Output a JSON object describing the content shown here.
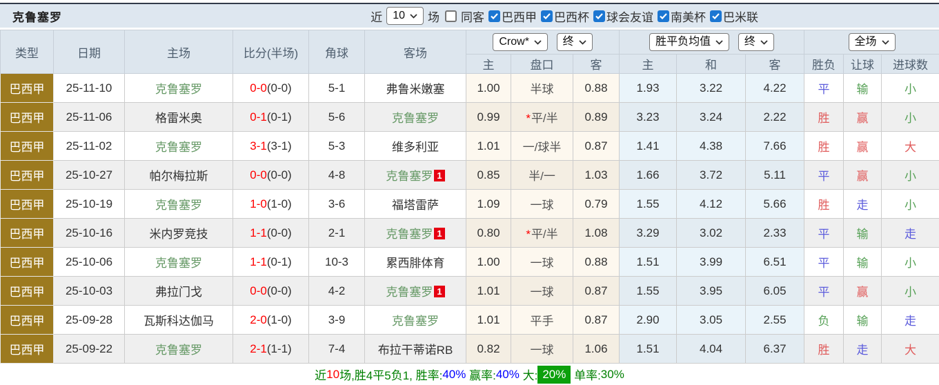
{
  "title": "克鲁塞罗",
  "filters": {
    "near_label": "近",
    "near_count": "10",
    "games_label": "场",
    "same_opponent_label": "同客",
    "competitions": [
      {
        "label": "巴西甲",
        "checked": true
      },
      {
        "label": "巴西杯",
        "checked": true
      },
      {
        "label": "球会友谊",
        "checked": true
      },
      {
        "label": "南美杯",
        "checked": true
      },
      {
        "label": "巴米联",
        "checked": true
      }
    ]
  },
  "table": {
    "headers": [
      "类型",
      "日期",
      "主场",
      "比分(半场)",
      "角球",
      "客场"
    ],
    "selects": {
      "provider": "Crow*",
      "provider_time": "终",
      "mean": "胜平负均值",
      "mean_time": "终",
      "scope": "全场"
    },
    "subheaders": [
      "主",
      "盘口",
      "客",
      "主",
      "和",
      "客",
      "胜负",
      "让球",
      "进球数"
    ],
    "rows": [
      {
        "league": "巴西甲",
        "date": "25-11-10",
        "home": "克鲁塞罗",
        "home_highlight": true,
        "score_ft": "0-0",
        "score_ht": "(0-0)",
        "corner": "5-1",
        "away": "弗鲁米嫩塞",
        "away_highlight": false,
        "away_badge": "",
        "crow_home": "1.00",
        "handicap": "半球",
        "handicap_star": false,
        "crow_away": "0.88",
        "mean_home": "1.93",
        "mean_draw": "3.22",
        "mean_away": "4.22",
        "result": "平",
        "handicap_result": "输",
        "goals": "小"
      },
      {
        "league": "巴西甲",
        "date": "25-11-06",
        "home": "格雷米奥",
        "home_highlight": false,
        "score_ft": "0-1",
        "score_ht": "(0-1)",
        "corner": "5-6",
        "away": "克鲁塞罗",
        "away_highlight": true,
        "away_badge": "",
        "crow_home": "0.99",
        "handicap": "平/半",
        "handicap_star": true,
        "crow_away": "0.89",
        "mean_home": "3.23",
        "mean_draw": "3.24",
        "mean_away": "2.22",
        "result": "胜",
        "handicap_result": "赢",
        "goals": "小"
      },
      {
        "league": "巴西甲",
        "date": "25-11-02",
        "home": "克鲁塞罗",
        "home_highlight": true,
        "score_ft": "3-1",
        "score_ht": "(3-1)",
        "corner": "5-3",
        "away": "维多利亚",
        "away_highlight": false,
        "away_badge": "",
        "crow_home": "1.01",
        "handicap": "一/球半",
        "handicap_star": false,
        "crow_away": "0.87",
        "mean_home": "1.41",
        "mean_draw": "4.38",
        "mean_away": "7.66",
        "result": "胜",
        "handicap_result": "赢",
        "goals": "大"
      },
      {
        "league": "巴西甲",
        "date": "25-10-27",
        "home": "帕尔梅拉斯",
        "home_highlight": false,
        "score_ft": "0-0",
        "score_ht": "(0-0)",
        "corner": "4-8",
        "away": "克鲁塞罗",
        "away_highlight": true,
        "away_badge": "1",
        "crow_home": "0.85",
        "handicap": "半/一",
        "handicap_star": false,
        "crow_away": "1.03",
        "mean_home": "1.66",
        "mean_draw": "3.72",
        "mean_away": "5.11",
        "result": "平",
        "handicap_result": "赢",
        "goals": "小"
      },
      {
        "league": "巴西甲",
        "date": "25-10-19",
        "home": "克鲁塞罗",
        "home_highlight": true,
        "score_ft": "1-0",
        "score_ht": "(1-0)",
        "corner": "3-6",
        "away": "福塔雷萨",
        "away_highlight": false,
        "away_badge": "",
        "crow_home": "1.09",
        "handicap": "一球",
        "handicap_star": false,
        "crow_away": "0.79",
        "mean_home": "1.55",
        "mean_draw": "4.12",
        "mean_away": "5.66",
        "result": "胜",
        "handicap_result": "走",
        "goals": "小"
      },
      {
        "league": "巴西甲",
        "date": "25-10-16",
        "home": "米内罗竞技",
        "home_highlight": false,
        "score_ft": "1-1",
        "score_ht": "(0-0)",
        "corner": "2-1",
        "away": "克鲁塞罗",
        "away_highlight": true,
        "away_badge": "1",
        "crow_home": "0.80",
        "handicap": "平/半",
        "handicap_star": true,
        "crow_away": "1.08",
        "mean_home": "3.29",
        "mean_draw": "3.02",
        "mean_away": "2.33",
        "result": "平",
        "handicap_result": "输",
        "goals": "走"
      },
      {
        "league": "巴西甲",
        "date": "25-10-06",
        "home": "克鲁塞罗",
        "home_highlight": true,
        "score_ft": "1-1",
        "score_ht": "(0-1)",
        "corner": "10-3",
        "away": "累西腓体育",
        "away_highlight": false,
        "away_badge": "",
        "crow_home": "1.00",
        "handicap": "一球",
        "handicap_star": false,
        "crow_away": "0.88",
        "mean_home": "1.51",
        "mean_draw": "3.99",
        "mean_away": "6.51",
        "result": "平",
        "handicap_result": "输",
        "goals": "小"
      },
      {
        "league": "巴西甲",
        "date": "25-10-03",
        "home": "弗拉门戈",
        "home_highlight": false,
        "score_ft": "0-0",
        "score_ht": "(0-0)",
        "corner": "4-2",
        "away": "克鲁塞罗",
        "away_highlight": true,
        "away_badge": "1",
        "crow_home": "1.01",
        "handicap": "一球",
        "handicap_star": false,
        "crow_away": "0.87",
        "mean_home": "1.55",
        "mean_draw": "3.95",
        "mean_away": "6.05",
        "result": "平",
        "handicap_result": "赢",
        "goals": "小"
      },
      {
        "league": "巴西甲",
        "date": "25-09-28",
        "home": "瓦斯科达伽马",
        "home_highlight": false,
        "score_ft": "2-0",
        "score_ht": "(1-0)",
        "corner": "3-9",
        "away": "克鲁塞罗",
        "away_highlight": true,
        "away_badge": "",
        "crow_home": "1.01",
        "handicap": "平手",
        "handicap_star": false,
        "crow_away": "0.87",
        "mean_home": "2.90",
        "mean_draw": "3.05",
        "mean_away": "2.55",
        "result": "负",
        "handicap_result": "输",
        "goals": "走"
      },
      {
        "league": "巴西甲",
        "date": "25-09-22",
        "home": "克鲁塞罗",
        "home_highlight": true,
        "score_ft": "2-1",
        "score_ht": "(1-1)",
        "corner": "7-4",
        "away": "布拉干蒂诺RB",
        "away_highlight": false,
        "away_badge": "",
        "crow_home": "0.82",
        "handicap": "一球",
        "handicap_star": false,
        "crow_away": "1.06",
        "mean_home": "1.51",
        "mean_draw": "4.04",
        "mean_away": "6.37",
        "result": "胜",
        "handicap_result": "走",
        "goals": "大"
      }
    ]
  },
  "footer": {
    "segments": [
      {
        "text": "近",
        "color": "green"
      },
      {
        "text": "10",
        "color": "red"
      },
      {
        "text": "场,胜4平5负1, 胜率:",
        "color": "green"
      },
      {
        "text": "40%",
        "color": "blue"
      },
      {
        "text": " 赢率:",
        "color": "green"
      },
      {
        "text": "40%",
        "color": "blue"
      },
      {
        "text": " 大:",
        "color": "green"
      },
      {
        "text": "20%",
        "color": "white",
        "box": "box_green"
      },
      {
        "text": " 单率:",
        "color": "green"
      },
      {
        "text": "30%",
        "color": "green"
      }
    ]
  },
  "colors": {
    "palette": {
      "green": "#008000",
      "red": "#ff0000",
      "blue": "#0000ff",
      "white": "#ffffff",
      "box_green": "#0ca00c"
    },
    "result_map": {
      "胜": "#e05c5c",
      "平": "#5c5cdc",
      "负": "#55a055",
      "赢": "#e05c5c",
      "走": "#5c5cdc",
      "输": "#55a055",
      "大": "#e05c5c",
      "小": "#55a055"
    },
    "accent_gold": "#9c7a1f",
    "team_link_green": "#669966",
    "score_red": "#ff0000",
    "checkbox_blue": "#1b76d2"
  }
}
